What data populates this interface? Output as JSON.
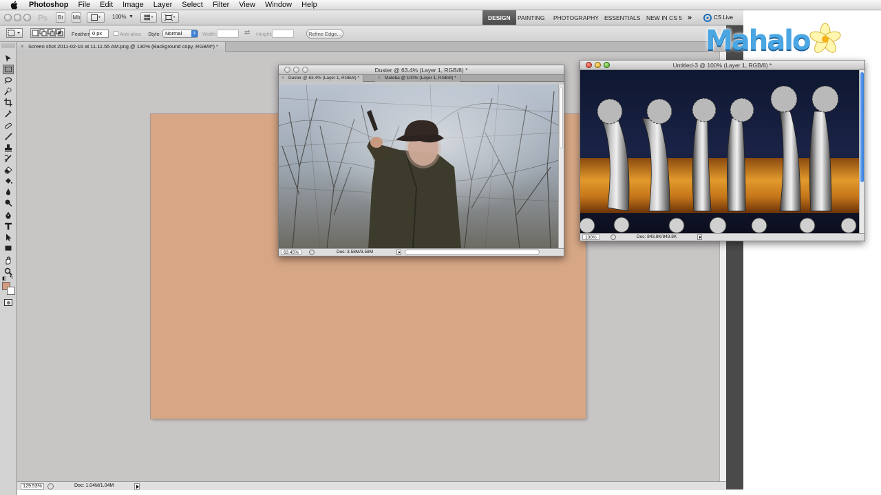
{
  "menubar": {
    "app_name": "Photoshop",
    "items": [
      "File",
      "Edit",
      "Image",
      "Layer",
      "Select",
      "Filter",
      "View",
      "Window",
      "Help"
    ]
  },
  "appbar": {
    "logo_text": "Ps",
    "br_label": "Br",
    "mb_label": "Mb",
    "zoom": "100%",
    "workspaces": [
      "DESIGN",
      "PAINTING",
      "PHOTOGRAPHY",
      "ESSENTIALS",
      "NEW IN CS 5"
    ],
    "active_workspace": "DESIGN",
    "more_label": "»",
    "cs_live": "CS Live"
  },
  "options": {
    "feather_label": "Feather:",
    "feather_value": "0 px",
    "antialias_label": "Anti-alias",
    "style_label": "Style:",
    "style_value": "Normal",
    "width_label": "Width:",
    "height_label": "Height:",
    "refine_edge": "Refine Edge..."
  },
  "document_tab": {
    "label": "Screen shot 2011-02-16 at 11.11.55 AM.png @ 130% (Background copy, RGB/8*) *",
    "close": "×"
  },
  "status": {
    "zoom": "129.53%",
    "doc": "Doc: 1.04M/1.04M"
  },
  "duster_window": {
    "title": "Duster @ 63.4% (Layer 1, RGB/8) *",
    "tabs": [
      "Duster @ 63.4% (Layer 1, RGB/8) *",
      "Mateba @ 100% (Layer 1, RGB/8) *"
    ],
    "zoom": "63.45%",
    "doc": "Doc: 3.58M/3.58M"
  },
  "spurs_window": {
    "title": "Untitled-3 @ 100% (Layer 1, RGB/8) *",
    "zoom": "100%",
    "doc": "Doc: 843.8K/843.8K"
  },
  "logo": {
    "text": "Mahalo"
  },
  "colors": {
    "artboard": "#d6a685",
    "foreground": "#d69c7e",
    "background": "#ffffff",
    "active_workspace_bg": "#4a4a4a",
    "logo_blue": "#4aa7e3"
  },
  "tools_icons": [
    "move-icon",
    "marquee-icon",
    "lasso-icon",
    "quick-select-icon",
    "crop-icon",
    "eyedropper-icon",
    "spot-heal-icon",
    "brush-icon",
    "clone-stamp-icon",
    "history-brush-icon",
    "eraser-icon",
    "paint-bucket-icon",
    "blur-icon",
    "dodge-icon",
    "pen-icon",
    "type-icon",
    "path-select-icon",
    "shape-icon",
    "hand-icon",
    "zoom-icon"
  ]
}
